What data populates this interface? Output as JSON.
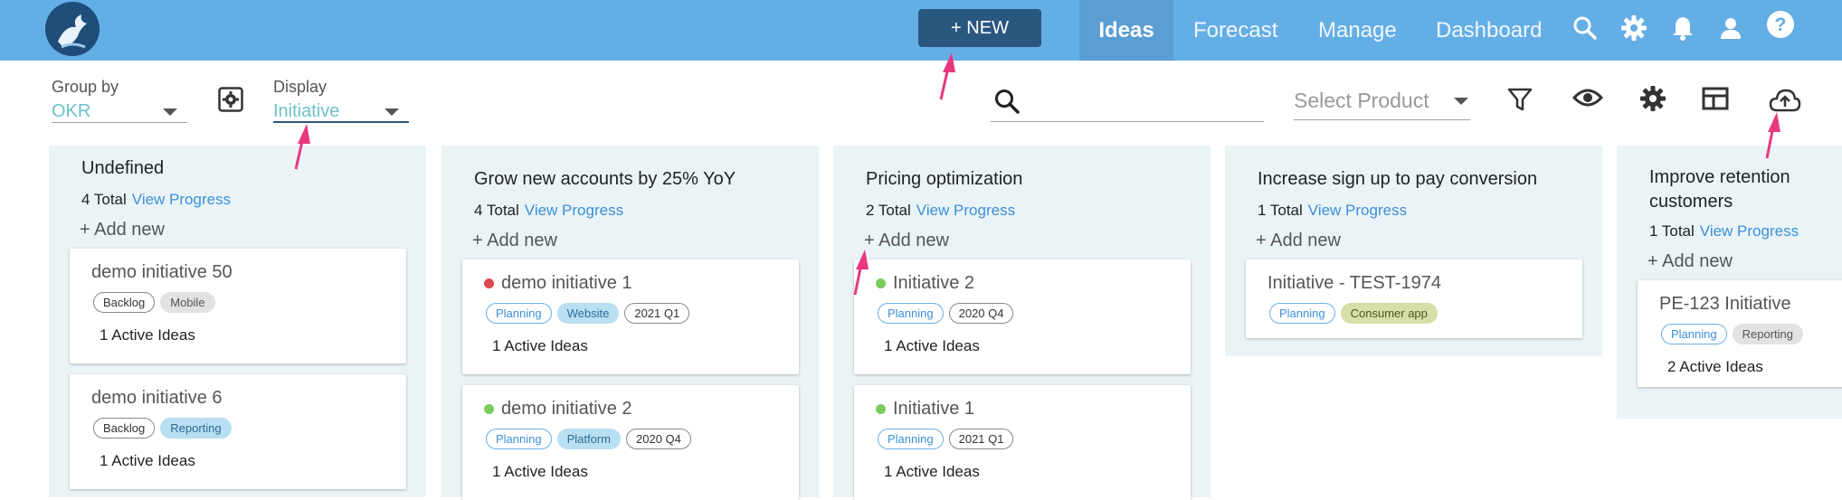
{
  "nav": {
    "new_label": "+ NEW",
    "items": [
      {
        "label": "Ideas",
        "active": true
      },
      {
        "label": "Forecast"
      },
      {
        "label": "Manage"
      },
      {
        "label": "Dashboard"
      }
    ],
    "icons": [
      "search-icon",
      "gear-icon",
      "bell-icon",
      "user-icon",
      "help-icon"
    ]
  },
  "toolbar": {
    "group_by_label": "Group by",
    "group_by_value": "OKR",
    "display_label": "Display",
    "display_value": "Initiative",
    "search_placeholder": "",
    "select_product_placeholder": "Select Product"
  },
  "columns": [
    {
      "title": "Undefined",
      "total": "4 Total",
      "view_progress": "View Progress",
      "add_new": "+ Add new",
      "cards": [
        {
          "title": "demo initiative 50",
          "status": "",
          "chips": [
            "Backlog",
            "Mobile"
          ],
          "active": "1 Active Ideas"
        },
        {
          "title": "demo initiative 6",
          "status": "",
          "chips": [
            "Backlog",
            "Reporting"
          ],
          "active": "1 Active Ideas"
        }
      ]
    },
    {
      "title": "Grow new accounts by 25% YoY",
      "total": "4 Total",
      "view_progress": "View Progress",
      "add_new": "+ Add new",
      "cards": [
        {
          "title": "demo initiative 1",
          "status": "#e0494f",
          "chips": [
            "Planning",
            "Website",
            "2021 Q1"
          ],
          "active": "1 Active Ideas"
        },
        {
          "title": "demo initiative 2",
          "status": "#7ccb5d",
          "chips": [
            "Planning",
            "Platform",
            "2020 Q4"
          ],
          "active": "1 Active Ideas"
        }
      ]
    },
    {
      "title": "Pricing optimization",
      "total": "2 Total",
      "view_progress": "View Progress",
      "add_new": "+ Add new",
      "cards": [
        {
          "title": "Initiative 2",
          "status": "#7ccb5d",
          "chips": [
            "Planning",
            "2020 Q4"
          ],
          "active": "1 Active Ideas"
        },
        {
          "title": "Initiative 1",
          "status": "#7ccb5d",
          "chips": [
            "Planning",
            "2021 Q1"
          ],
          "active": "1 Active Ideas"
        }
      ]
    },
    {
      "title": "Increase sign up to pay conversion",
      "total": "1 Total",
      "view_progress": "View Progress",
      "add_new": "+ Add new",
      "cards": [
        {
          "title": "Initiative - TEST-1974",
          "status": "",
          "chips": [
            "Planning",
            "Consumer app"
          ],
          "active": ""
        }
      ]
    },
    {
      "title_line1": "Improve retention",
      "title_line2": "customers",
      "total": "1 Total",
      "view_progress": "View Progress",
      "add_new": "+ Add new",
      "cards": [
        {
          "title": "PE-123 Initiative",
          "status": "",
          "chips": [
            "Planning",
            "Reporting"
          ],
          "active": "2 Active Ideas"
        }
      ]
    }
  ],
  "colors": {
    "topbar": "#64aee6",
    "new_button": "#2a5780",
    "accent_link": "#3b8fd9",
    "annotation_arrow": "#e8387f"
  }
}
